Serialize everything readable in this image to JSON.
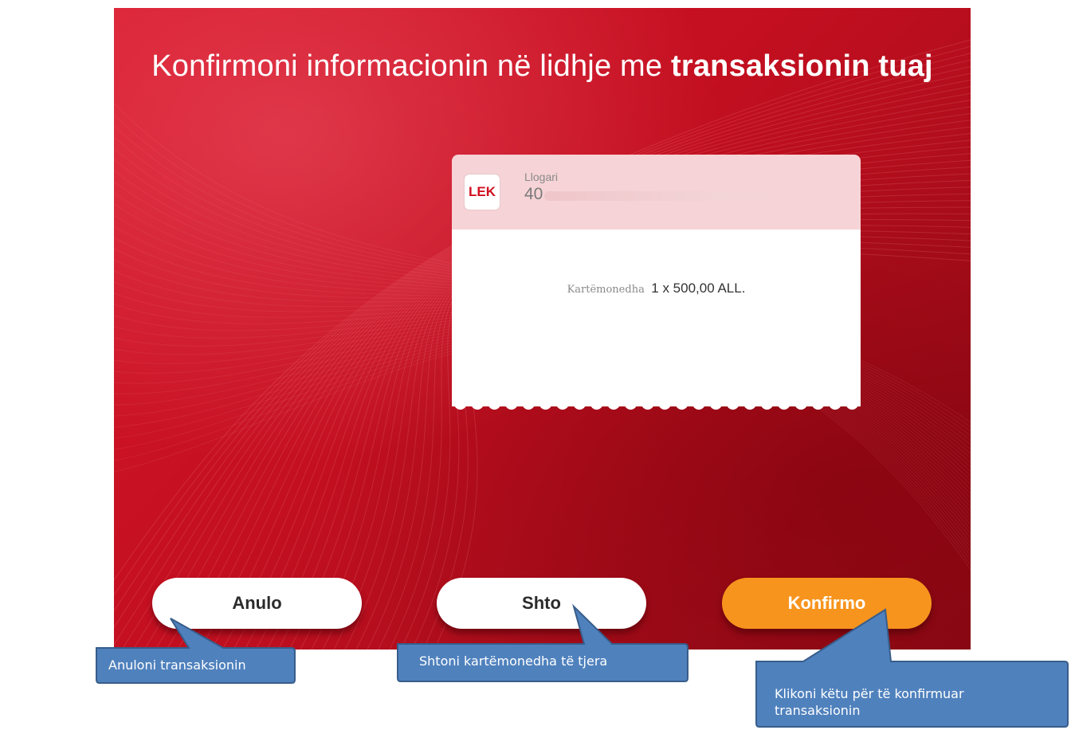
{
  "title": {
    "part1": "Konfirmoni informacionin në lidhje me",
    "part2": "transaksionin tuaj"
  },
  "receipt": {
    "logo_text": "LEK",
    "account_label": "Llogari",
    "account_number": "40",
    "denomination_label": "Kartëmonedha",
    "denomination_value": "1 x 500,00 ALL."
  },
  "buttons": {
    "cancel": "Anulo",
    "add": "Shto",
    "confirm": "Konfirmo"
  },
  "callouts": {
    "cancel": "Anuloni transaksionin",
    "add": "Shtoni kartëmonedha të tjera",
    "confirm_line1": "Klikoni këtu për të konfirmuar",
    "confirm_line2": "transaksionin"
  },
  "colors": {
    "background_red": "#c30f20",
    "confirm_orange": "#f7941d",
    "callout_blue": "#4f81bd"
  }
}
